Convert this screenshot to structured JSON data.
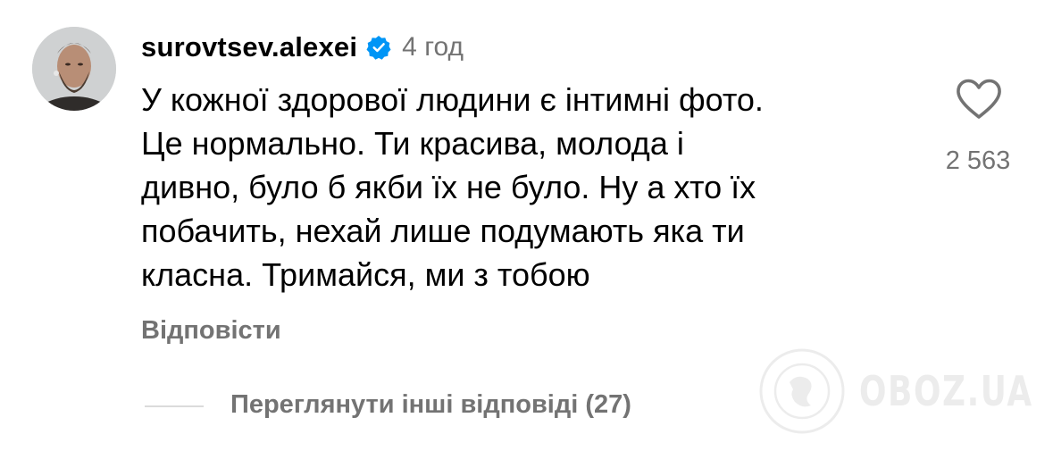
{
  "comment": {
    "username": "surovtsev.alexei",
    "verified": true,
    "verified_color": "#0095f6",
    "time_ago": "4 год",
    "text_lines": [
      "У кожної здорової людини є інтимні фото.",
      "Це нормально. Ти красива, молода і",
      "дивно, було б якби їх не було. Ну а хто їх",
      "побачить, нехай лише подумають яка ти",
      "класна. Тримайся, ми з тобою"
    ],
    "like_icon": "heart-outline-icon",
    "like_count": "2 563",
    "reply_label": "Відповісти",
    "view_replies_label": "Переглянути інші відповіді (27)"
  },
  "watermark": {
    "text": "OBOZ.UA",
    "icon": "globe-logo-icon"
  },
  "colors": {
    "text_primary": "#000000",
    "text_secondary": "#737373",
    "divider": "#dbdbdb",
    "background": "#ffffff"
  }
}
